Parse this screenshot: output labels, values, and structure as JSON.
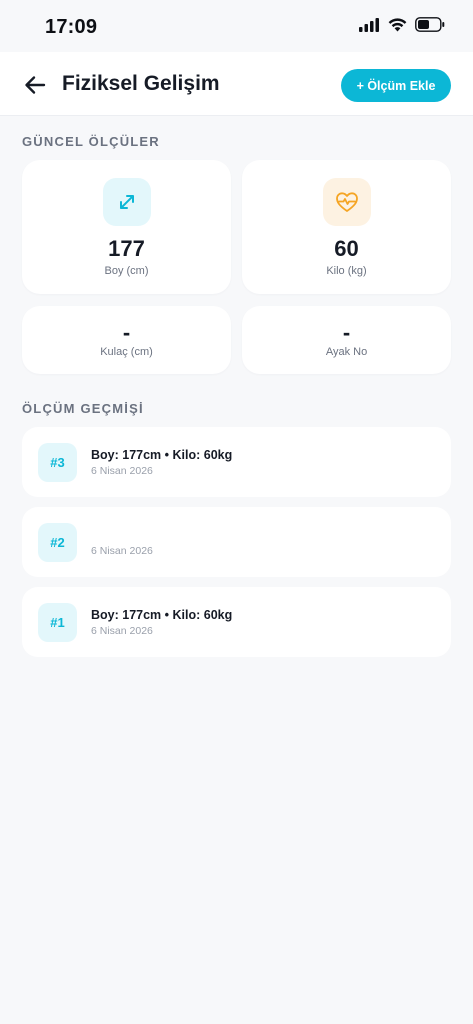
{
  "status_bar": {
    "time": "17:09",
    "icons": [
      "signal-icon",
      "wifi-icon",
      "battery-icon"
    ]
  },
  "header": {
    "title": "Fiziksel Gelişim",
    "back_icon": "arrow-left-icon",
    "add_button_label": "+ Ölçüm Ekle"
  },
  "current": {
    "section_title": "GÜNCEL ÖLÇÜLER",
    "height": {
      "value": "177",
      "label": "Boy (cm)",
      "icon": "expand-arrows-icon"
    },
    "weight": {
      "value": "60",
      "label": "Kilo (kg)",
      "icon": "heart-pulse-icon"
    },
    "arm_span": {
      "value": "-",
      "label": "Kulaç (cm)"
    },
    "shoe_size": {
      "value": "-",
      "label": "Ayak No"
    }
  },
  "history": {
    "section_title": "ÖLÇÜM GEÇMİŞİ",
    "items": [
      {
        "badge": "#3",
        "summary": "Boy: 177cm • Kilo: 60kg",
        "date": "6 Nisan 2026"
      },
      {
        "badge": "#2",
        "summary": "",
        "date": "6 Nisan 2026"
      },
      {
        "badge": "#1",
        "summary": "Boy: 177cm • Kilo: 60kg",
        "date": "6 Nisan 2026"
      }
    ]
  },
  "colors": {
    "accent": "#0cb7d6",
    "accent_soft": "#e3f7fb",
    "warning_icon": "#f5a524",
    "warning_soft": "#fdf2e2",
    "background": "#f7f8fa"
  }
}
